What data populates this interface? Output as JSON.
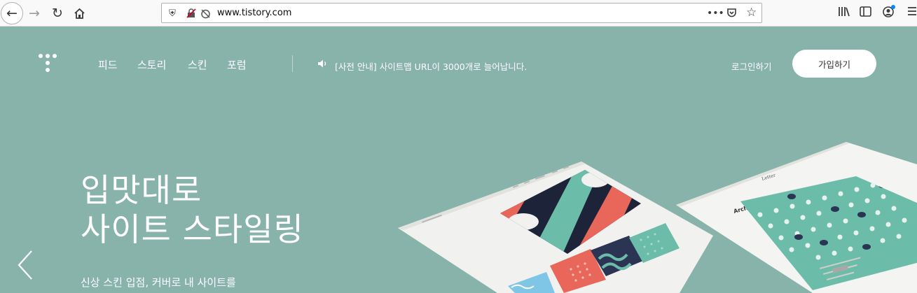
{
  "browser": {
    "url": "www.tistory.com"
  },
  "header": {
    "nav": [
      "피드",
      "스토리",
      "스킨",
      "포럼"
    ],
    "notice": "[사전 안내] 사이트맵 URL이 3000개로 늘어납니다.",
    "login_label": "로그인하기",
    "signup_label": "가입하기"
  },
  "hero": {
    "title_line1": "입맛대로",
    "title_line2": "사이트 스타일링",
    "subtitle": "신상 스킨 입점, 커버로 내 사이트를",
    "mockup_heading": "Architectural Issues",
    "mockup_brand": "Letter"
  },
  "colors": {
    "page_background": "#87b3ab",
    "coral": "#e8675a",
    "navy": "#1d2339",
    "mint": "#6bbda9"
  }
}
